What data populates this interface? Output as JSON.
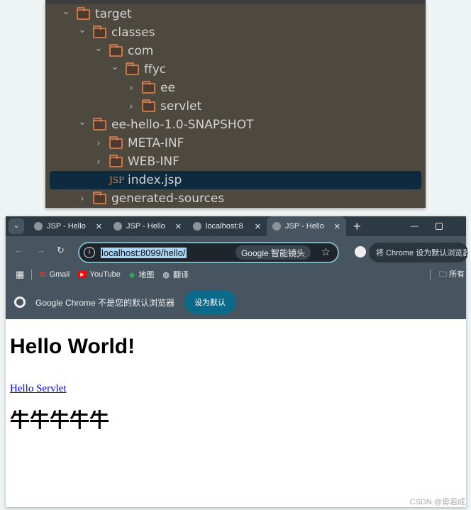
{
  "ide": {
    "tree": [
      {
        "label": "target",
        "depth": 0,
        "expanded": true,
        "type": "folder"
      },
      {
        "label": "classes",
        "depth": 1,
        "expanded": true,
        "type": "folder"
      },
      {
        "label": "com",
        "depth": 2,
        "expanded": true,
        "type": "folder"
      },
      {
        "label": "ffyc",
        "depth": 3,
        "expanded": true,
        "type": "folder"
      },
      {
        "label": "ee",
        "depth": 4,
        "expanded": false,
        "type": "folder"
      },
      {
        "label": "servlet",
        "depth": 4,
        "expanded": false,
        "type": "folder"
      },
      {
        "label": "ee-hello-1.0-SNAPSHOT",
        "depth": 1,
        "expanded": true,
        "type": "folder"
      },
      {
        "label": "META-INF",
        "depth": 2,
        "expanded": false,
        "type": "folder"
      },
      {
        "label": "WEB-INF",
        "depth": 2,
        "expanded": false,
        "type": "folder"
      },
      {
        "label": "index.jsp",
        "depth": 2,
        "type": "jsp",
        "selected": true,
        "icon_text": "JSP"
      },
      {
        "label": "generated-sources",
        "depth": 1,
        "expanded": false,
        "type": "folder"
      }
    ]
  },
  "browser": {
    "tabs": [
      {
        "label": "JSP - Hello"
      },
      {
        "label": "JSP - Hello"
      },
      {
        "label": "localhost:8"
      },
      {
        "label": "JSP - Hello",
        "active": true
      }
    ],
    "url": "localhost:8099/hello/",
    "lens_label": "Google 智能镜头",
    "set_default_chip": "将 Chrome 设为默认浏览器",
    "bookmarks": [
      {
        "label": "Gmail",
        "color": "#ea4335"
      },
      {
        "label": "YouTube",
        "color": "#ff0000"
      },
      {
        "label": "地图",
        "color": "#34a853"
      },
      {
        "label": "翻译",
        "color": "#ffffff"
      }
    ],
    "all_bookmarks": "所有",
    "infobar": {
      "text": "Google Chrome 不是您的默认浏览器",
      "button": "设为默认"
    },
    "page": {
      "heading": "Hello World!",
      "link": "Hello Servlet",
      "subheading": "牛牛牛牛牛"
    }
  },
  "watermark": "CSDN @毋若成"
}
